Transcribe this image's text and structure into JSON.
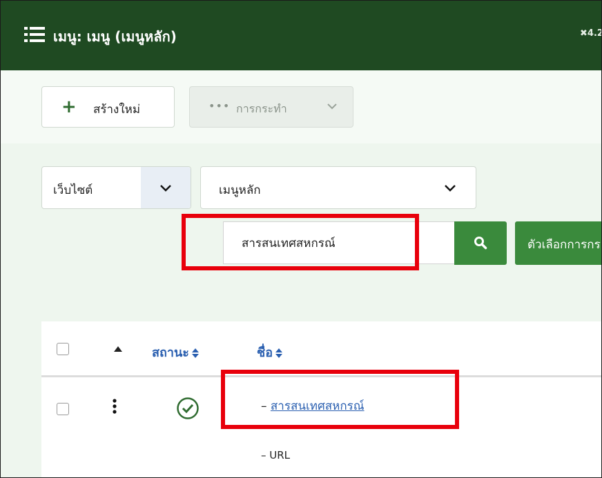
{
  "header": {
    "title": "เมนู: เมนู (เมนูหลัก)",
    "version": "4.2"
  },
  "toolbar": {
    "new_label": "สร้างใหม่",
    "actions_label": "การกระทำ"
  },
  "filters": {
    "site_value": "เว็บไซต์",
    "menu_value": "เมนูหลัก",
    "search_value": "สารสนเทศสหกรณ์",
    "options_label": "ตัวเลือกการกรอง"
  },
  "table": {
    "headers": {
      "status": "สถานะ",
      "name": "ชื่อ"
    },
    "rows": [
      {
        "dash": "–",
        "name": "สารสนเทศสหกรณ์",
        "dash2": "–",
        "url_prefix": "–",
        "type": "URL"
      }
    ]
  },
  "colors": {
    "header_bg": "#1f4a22",
    "accent_green": "#3a8a3c",
    "link_blue": "#2a5fb0",
    "highlight_red": "#e8000b"
  }
}
